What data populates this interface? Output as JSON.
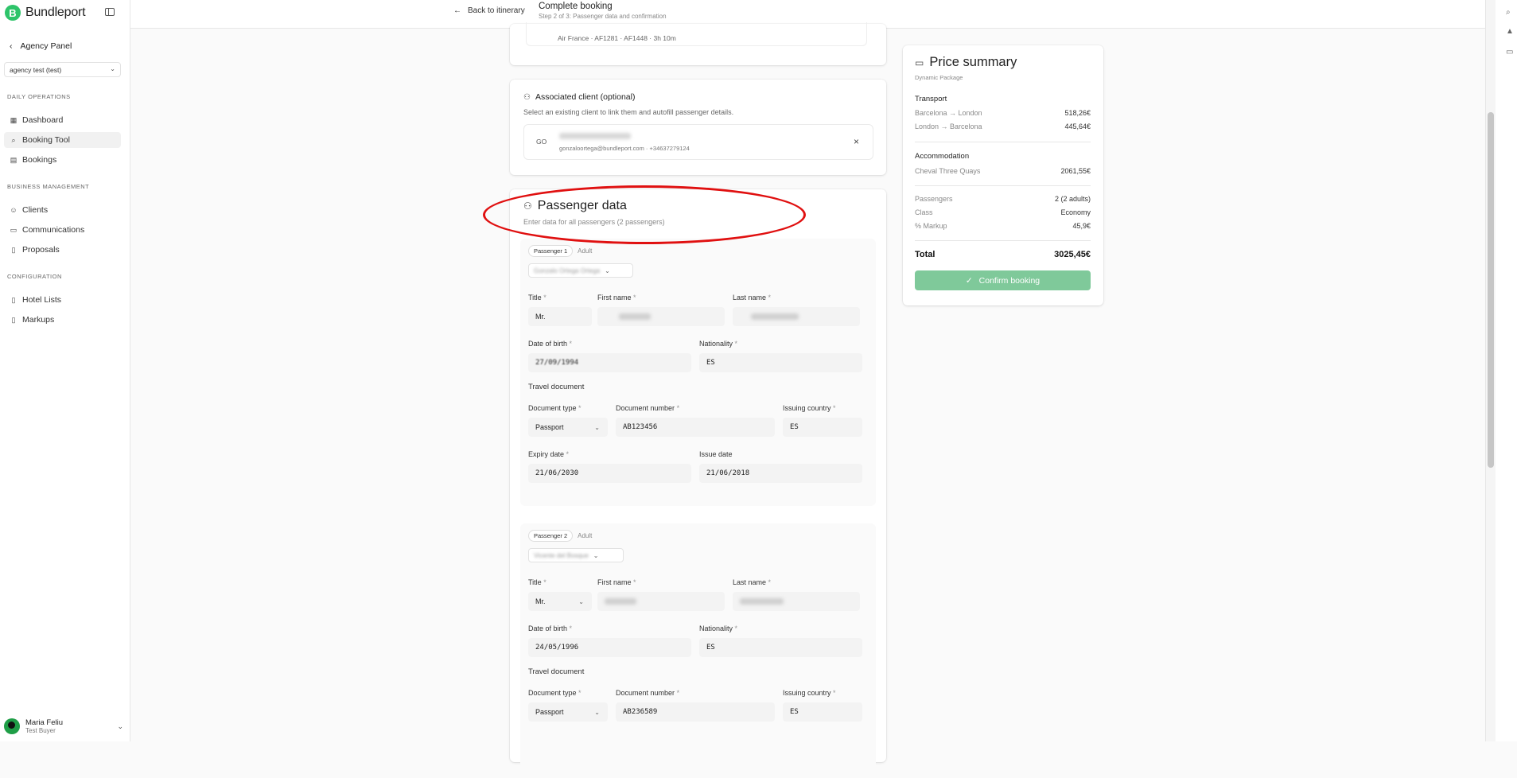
{
  "sidebar": {
    "brand": "Bundleport",
    "panel_link": "Agency Panel",
    "agency_select": "agency test (test)",
    "sections": [
      {
        "title": "DAILY OPERATIONS",
        "items": [
          "Dashboard",
          "Booking Tool",
          "Bookings"
        ]
      },
      {
        "title": "BUSINESS MANAGEMENT",
        "items": [
          "Clients",
          "Communications",
          "Proposals"
        ]
      },
      {
        "title": "CONFIGURATION",
        "items": [
          "Hotel Lists",
          "Markups"
        ]
      }
    ],
    "active_item": "Booking Tool",
    "user": {
      "name": "Maria Feliu",
      "role": "Test Buyer"
    }
  },
  "topbar": {
    "back_label": "Back to itinerary",
    "title": "Complete booking",
    "subtitle": "Step 2 of 3: Passenger data and confirmation"
  },
  "flight": {
    "summary": "Air France · AF1281 · AF1448 · 3h 10m"
  },
  "client": {
    "title": "Associated client (optional)",
    "description": "Select an existing client to link them and autofill passenger details.",
    "initials": "GO",
    "contact": "gonzaloortega@bundleport.com · +34637279124"
  },
  "passengers": {
    "title": "Passenger data",
    "description": "Enter data for all passengers (2 passengers)",
    "labels": {
      "title": "Title",
      "first_name": "First name",
      "last_name": "Last name",
      "dob": "Date of birth",
      "nationality": "Nationality",
      "travel_document": "Travel document",
      "doc_type": "Document type",
      "doc_number": "Document number",
      "issuing_country": "Issuing country",
      "expiry_date": "Expiry date",
      "issue_date": "Issue date"
    },
    "list": [
      {
        "tag": "Passenger 1",
        "type": "Adult",
        "selector": "Gonzalo Ortega Ortega",
        "title": "Mr.",
        "dob": "27/09/1994",
        "nationality": "ES",
        "doc_type": "Passport",
        "doc_number": "AB123456",
        "issuing_country": "ES",
        "expiry_date": "21/06/2030",
        "issue_date": "21/06/2018"
      },
      {
        "tag": "Passenger 2",
        "type": "Adult",
        "selector": "Vicente del Bosque",
        "title": "Mr.",
        "dob": "24/05/1996",
        "nationality": "ES",
        "doc_type": "Passport",
        "doc_number": "AB236589",
        "issuing_country": "ES"
      }
    ]
  },
  "price_summary": {
    "title": "Price summary",
    "subtitle": "Dynamic Package",
    "transport_label": "Transport",
    "transport": [
      {
        "route": "Barcelona → London",
        "price": "518,26€"
      },
      {
        "route": "London → Barcelona",
        "price": "445,64€"
      }
    ],
    "accommodation_label": "Accommodation",
    "accommodation": [
      {
        "name": "Cheval Three Quays",
        "price": "2061,55€"
      }
    ],
    "details": [
      {
        "label": "Passengers",
        "value": "2 (2 adults)"
      },
      {
        "label": "Class",
        "value": "Economy"
      },
      {
        "label": "% Markup",
        "value": "45,9€"
      }
    ],
    "total_label": "Total",
    "total_value": "3025,45€",
    "confirm_label": "Confirm booking"
  },
  "colors": {
    "brand": "#2ec46a",
    "confirm": "#7fc99a",
    "highlight": "#e01010"
  }
}
